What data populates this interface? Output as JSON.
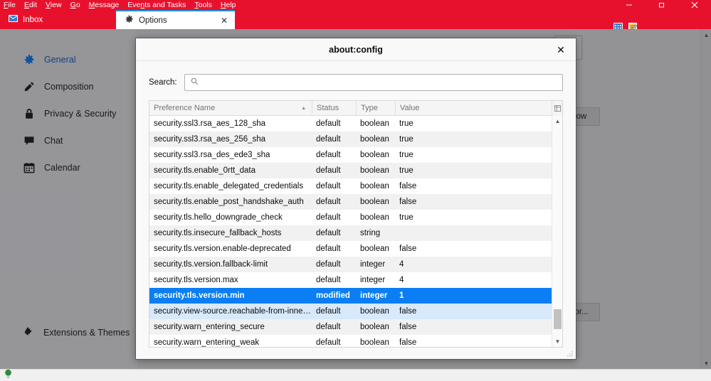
{
  "window": {
    "menus": [
      {
        "label": "File",
        "mnemonic": "F"
      },
      {
        "label": "Edit",
        "mnemonic": "E"
      },
      {
        "label": "View",
        "mnemonic": "V"
      },
      {
        "label": "Go",
        "mnemonic": "G"
      },
      {
        "label": "Message",
        "mnemonic": "M"
      },
      {
        "label": "Events and Tasks",
        "mnemonic": "n"
      },
      {
        "label": "Tools",
        "mnemonic": "T"
      },
      {
        "label": "Help",
        "mnemonic": "H"
      }
    ],
    "controls": {
      "minimize": "minimize-button",
      "restore": "restore-button",
      "close": "close-button"
    },
    "titlebar_color": "#e8112d"
  },
  "tabs": [
    {
      "label": "Inbox",
      "icon": "mail-icon",
      "active": false
    },
    {
      "label": "Options",
      "icon": "gear-icon",
      "active": true,
      "close": "✕"
    }
  ],
  "toolbar_icons": [
    {
      "name": "calendar-grid-icon"
    },
    {
      "name": "tasks-note-icon"
    }
  ],
  "sidebar": {
    "items": [
      {
        "label": "General",
        "icon": "gear-icon",
        "active": true
      },
      {
        "label": "Composition",
        "icon": "pencil-icon",
        "active": false
      },
      {
        "label": "Privacy & Security",
        "icon": "lock-icon",
        "active": false
      },
      {
        "label": "Chat",
        "icon": "chat-bubble-icon",
        "active": false
      },
      {
        "label": "Calendar",
        "icon": "calendar-icon",
        "active": false
      }
    ],
    "bottom_item": {
      "label": "Extensions & Themes",
      "icon": "puzzle-piece-icon"
    }
  },
  "background_page": {
    "buttons": [
      {
        "label": "ow",
        "name": "partially-hidden-show-button"
      },
      {
        "label": "or...",
        "name": "partially-hidden-editor-button"
      }
    ]
  },
  "statusbar": {
    "icon": "network-globe-icon"
  },
  "dialog": {
    "title": "about:config",
    "close_label": "✕",
    "search": {
      "label": "Search:",
      "value": "",
      "placeholder": "",
      "icon": "search-icon"
    },
    "table": {
      "columns": [
        {
          "label": "Preference Name",
          "sorted": "asc",
          "sort_glyph": "▲"
        },
        {
          "label": "Status"
        },
        {
          "label": "Type"
        },
        {
          "label": "Value"
        }
      ],
      "column_picker_icon": "column-options-icon",
      "rows": [
        {
          "name": "security.ssl3.rsa_aes_128_sha",
          "status": "default",
          "type": "boolean",
          "value": "true",
          "state": "normal"
        },
        {
          "name": "security.ssl3.rsa_aes_256_sha",
          "status": "default",
          "type": "boolean",
          "value": "true",
          "state": "normal"
        },
        {
          "name": "security.ssl3.rsa_des_ede3_sha",
          "status": "default",
          "type": "boolean",
          "value": "true",
          "state": "normal"
        },
        {
          "name": "security.tls.enable_0rtt_data",
          "status": "default",
          "type": "boolean",
          "value": "true",
          "state": "normal"
        },
        {
          "name": "security.tls.enable_delegated_credentials",
          "status": "default",
          "type": "boolean",
          "value": "false",
          "state": "normal"
        },
        {
          "name": "security.tls.enable_post_handshake_auth",
          "status": "default",
          "type": "boolean",
          "value": "false",
          "state": "normal"
        },
        {
          "name": "security.tls.hello_downgrade_check",
          "status": "default",
          "type": "boolean",
          "value": "true",
          "state": "normal"
        },
        {
          "name": "security.tls.insecure_fallback_hosts",
          "status": "default",
          "type": "string",
          "value": "",
          "state": "normal"
        },
        {
          "name": "security.tls.version.enable-deprecated",
          "status": "default",
          "type": "boolean",
          "value": "false",
          "state": "normal"
        },
        {
          "name": "security.tls.version.fallback-limit",
          "status": "default",
          "type": "integer",
          "value": "4",
          "state": "normal"
        },
        {
          "name": "security.tls.version.max",
          "status": "default",
          "type": "integer",
          "value": "4",
          "state": "normal"
        },
        {
          "name": "security.tls.version.min",
          "status": "modified",
          "type": "integer",
          "value": "1",
          "state": "selected"
        },
        {
          "name": "security.view-source.reachable-from-inner-proto…",
          "status": "default",
          "type": "boolean",
          "value": "false",
          "state": "nextsel"
        },
        {
          "name": "security.warn_entering_secure",
          "status": "default",
          "type": "boolean",
          "value": "false",
          "state": "normal"
        },
        {
          "name": "security.warn_entering_weak",
          "status": "default",
          "type": "boolean",
          "value": "false",
          "state": "normal"
        }
      ],
      "selection_color": "#0b7ef4"
    }
  }
}
